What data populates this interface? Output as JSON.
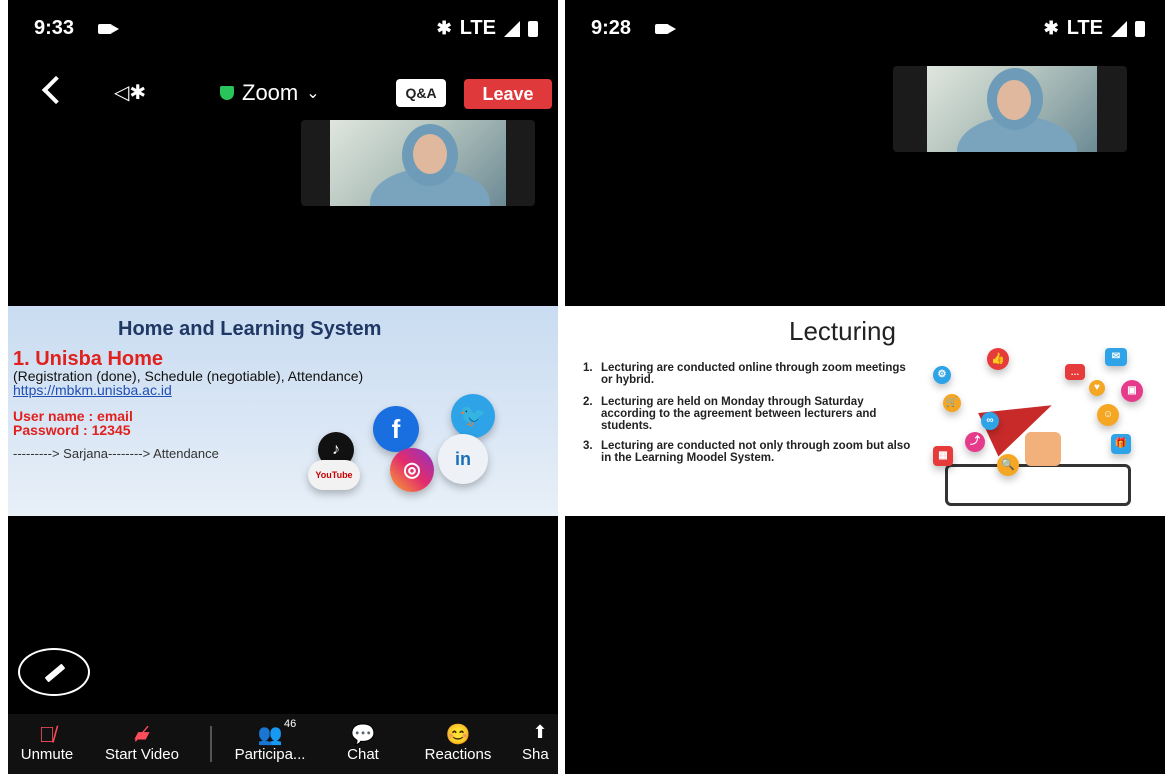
{
  "left": {
    "status": {
      "time": "9:33",
      "network": "LTE"
    },
    "topbar": {
      "title": "Zoom",
      "qa_label": "Q&A",
      "leave_label": "Leave"
    },
    "slide": {
      "title": "Home and Learning System",
      "heading": "1. Unisba Home",
      "line1": "(Registration (done), Schedule (negotiable), Attendance)",
      "link": "https://mbkm.unisba.ac.id",
      "username": "User name : email",
      "password": "Password   :  12345",
      "flow": "---------> Sarjana--------> Attendance",
      "youtube": "YouTube"
    },
    "toolbar": {
      "unmute": "Unmute",
      "start_video": "Start Video",
      "participants": "Participa...",
      "participants_count": "46",
      "chat": "Chat",
      "reactions": "Reactions",
      "share": "Sha"
    }
  },
  "right": {
    "status": {
      "time": "9:28",
      "network": "LTE"
    },
    "slide": {
      "title": "Lecturing",
      "items": [
        {
          "num": "1.",
          "text": "Lecturing  are conducted online through zoom meetings or hybrid."
        },
        {
          "num": "2.",
          "text": "Lecturing are held on Monday through Saturday according to the agreement between lecturers and students."
        },
        {
          "num": "3.",
          "text": "Lecturing are conducted not only through zoom but also in the Learning Moodel System."
        }
      ]
    }
  }
}
